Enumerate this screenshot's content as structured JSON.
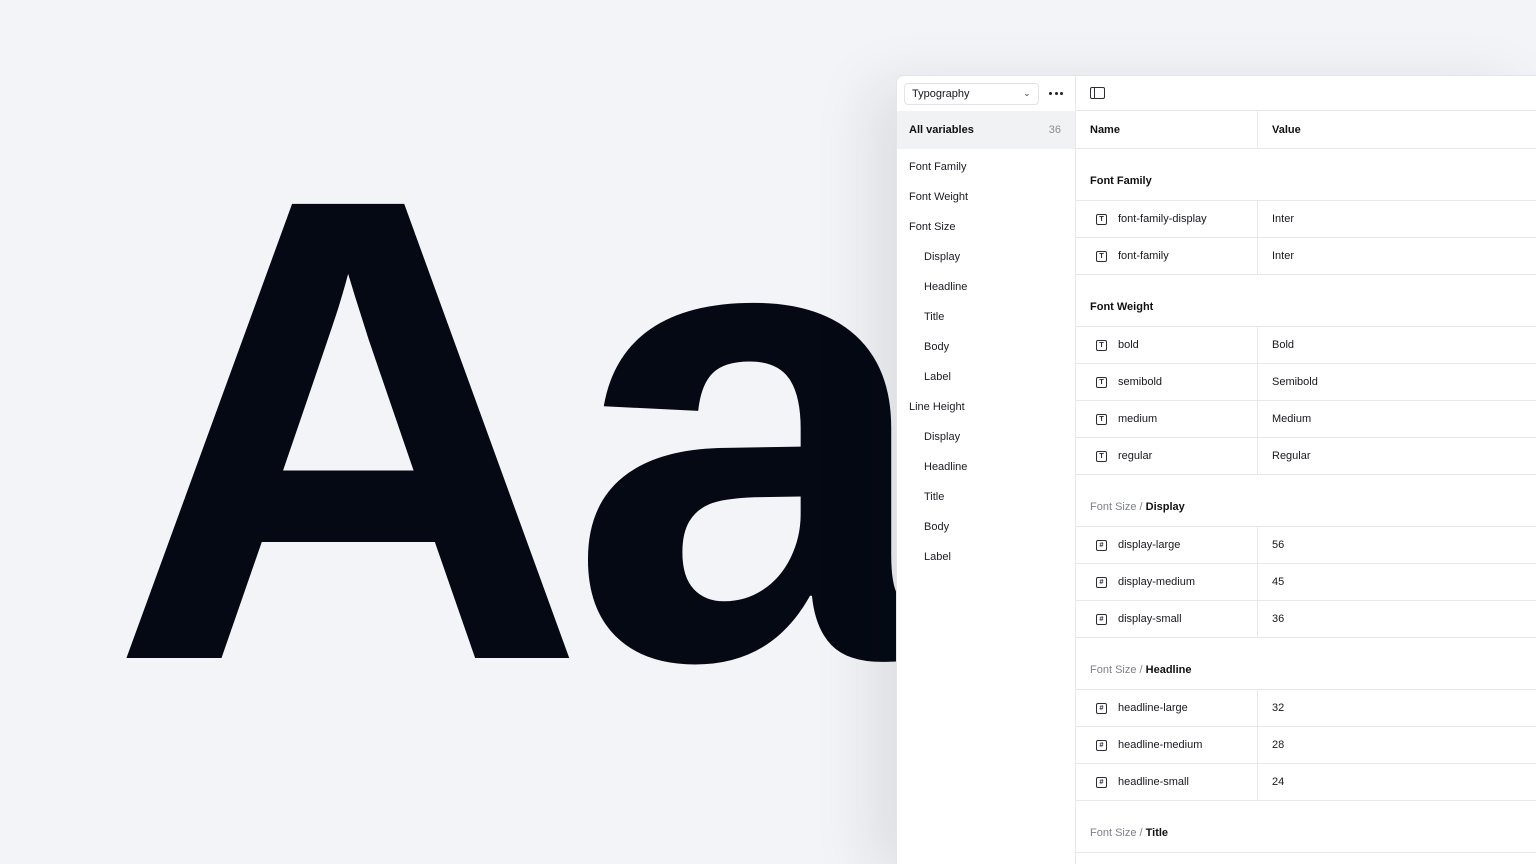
{
  "specimen": {
    "text": "Aa"
  },
  "sidebar": {
    "collection": "Typography",
    "all_variables": {
      "label": "All variables",
      "count": "36"
    },
    "groups": [
      {
        "label": "Font Family",
        "level": 0
      },
      {
        "label": "Font Weight",
        "level": 0
      },
      {
        "label": "Font Size",
        "level": 0
      },
      {
        "label": "Display",
        "level": 1
      },
      {
        "label": "Headline",
        "level": 1
      },
      {
        "label": "Title",
        "level": 1
      },
      {
        "label": "Body",
        "level": 1
      },
      {
        "label": "Label",
        "level": 1
      },
      {
        "label": "Line Height",
        "level": 0
      },
      {
        "label": "Display",
        "level": 1
      },
      {
        "label": "Headline",
        "level": 1
      },
      {
        "label": "Title",
        "level": 1
      },
      {
        "label": "Body",
        "level": 1
      },
      {
        "label": "Label",
        "level": 1
      }
    ]
  },
  "table": {
    "headers": {
      "name": "Name",
      "value": "Value"
    },
    "sections": [
      {
        "parent": "",
        "title": "Font Family",
        "rows": [
          {
            "icon": "text-type-icon",
            "name": "font-family-display",
            "value": "Inter"
          },
          {
            "icon": "text-type-icon",
            "name": "font-family",
            "value": "Inter"
          }
        ]
      },
      {
        "parent": "",
        "title": "Font Weight",
        "rows": [
          {
            "icon": "text-type-icon",
            "name": "bold",
            "value": "Bold"
          },
          {
            "icon": "text-type-icon",
            "name": "semibold",
            "value": "Semibold"
          },
          {
            "icon": "text-type-icon",
            "name": "medium",
            "value": "Medium"
          },
          {
            "icon": "text-type-icon",
            "name": "regular",
            "value": "Regular"
          }
        ]
      },
      {
        "parent": "Font Size",
        "title": "Display",
        "rows": [
          {
            "icon": "number-type-icon",
            "name": "display-large",
            "value": "56"
          },
          {
            "icon": "number-type-icon",
            "name": "display-medium",
            "value": "45"
          },
          {
            "icon": "number-type-icon",
            "name": "display-small",
            "value": "36"
          }
        ]
      },
      {
        "parent": "Font Size",
        "title": "Headline",
        "rows": [
          {
            "icon": "number-type-icon",
            "name": "headline-large",
            "value": "32"
          },
          {
            "icon": "number-type-icon",
            "name": "headline-medium",
            "value": "28"
          },
          {
            "icon": "number-type-icon",
            "name": "headline-small",
            "value": "24"
          }
        ]
      },
      {
        "parent": "Font Size",
        "title": "Title",
        "rows": []
      }
    ]
  },
  "colors": {
    "background": "#f3f4f7",
    "specimen": "#040913",
    "panel": "#ffffff",
    "border": "#e6e8ec"
  }
}
